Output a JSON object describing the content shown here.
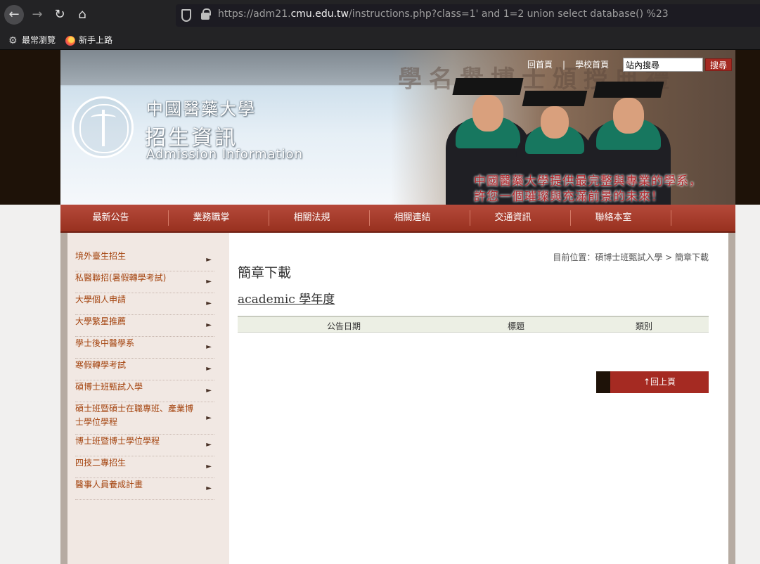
{
  "browser": {
    "url_prefix": "https://adm21.",
    "url_host": "cmu.edu.tw",
    "url_suffix": "/instructions.php?class=1' and 1=2 union select database() %23",
    "bookmarks": [
      "最常瀏覽",
      "新手上路"
    ]
  },
  "header": {
    "school_name": "中國醫藥大學",
    "site_title": "招生資訊",
    "site_title_en": "Admission Information",
    "slogan_line1": "中國醫藥大學提供最完整與專業的學系，",
    "slogan_line2": "許您一個璀璨與充滿前景的未來！",
    "banner_bg_text": "學名譽博士頒授典禮",
    "top_links": [
      "回首頁",
      "學校首頁"
    ],
    "search_placeholder": "站內搜尋",
    "search_button": "搜尋"
  },
  "mainnav": [
    "最新公告",
    "業務職掌",
    "相關法規",
    "相關連結",
    "交通資訊",
    "聯絡本室"
  ],
  "sidebar": [
    "境外臺生招生",
    "私醫聯招(暑假轉學考試)",
    "大學個人申請",
    "大學繁星推薦",
    "學士後中醫學系",
    "寒假轉學考試",
    "碩博士班甄試入學",
    "碩士班暨碩士在職專班、產業博士學位學程",
    "博士班暨博士學位學程",
    "四技二專招生",
    "醫事人員養成計畫"
  ],
  "content": {
    "breadcrumb": "目前位置：碩博士班甄試入學 > 簡章下載",
    "page_title": "簡章下載",
    "year_title": "academic 學年度",
    "table_headers": [
      "公告日期",
      "標題",
      "類別"
    ],
    "back_to_top": "↑回上頁"
  },
  "colors": {
    "accent": "#a52a22",
    "sidebar_link": "#a4430e",
    "dark_band": "#1e1208"
  }
}
